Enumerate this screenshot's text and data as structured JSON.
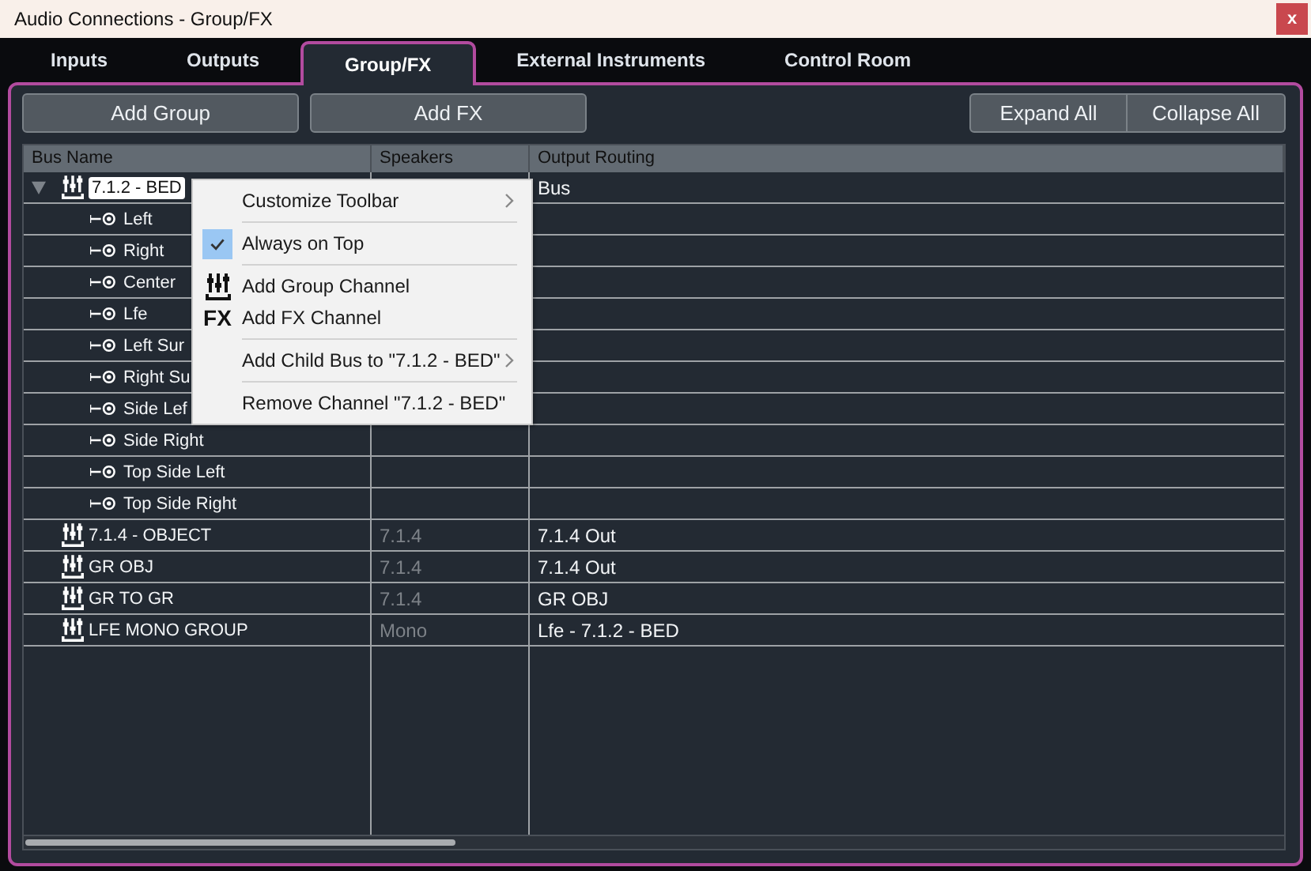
{
  "window": {
    "title": "Audio Connections - Group/FX",
    "close": "x"
  },
  "tabs": [
    {
      "label": "Inputs",
      "selected": false
    },
    {
      "label": "Outputs",
      "selected": false
    },
    {
      "label": "Group/FX",
      "selected": true
    },
    {
      "label": "External Instruments",
      "selected": false
    },
    {
      "label": "Control Room",
      "selected": false
    }
  ],
  "toolbar": {
    "left": [
      "Add Group",
      "Add FX"
    ],
    "right": [
      "Expand All",
      "Collapse All"
    ]
  },
  "table": {
    "columns": [
      "Bus Name",
      "Speakers",
      "Output Routing"
    ],
    "rows": [
      {
        "kind": "group",
        "name": "7.1.2 - BED",
        "editing": true,
        "expanded": true,
        "output": "Bus",
        "children": [
          {
            "kind": "channel",
            "name": "Left"
          },
          {
            "kind": "channel",
            "name": "Right"
          },
          {
            "kind": "channel",
            "name": "Center"
          },
          {
            "kind": "channel",
            "name": "Lfe"
          },
          {
            "kind": "channel",
            "name": "Left Sur"
          },
          {
            "kind": "channel",
            "name": "Right Su"
          },
          {
            "kind": "channel",
            "name": "Side Lef"
          },
          {
            "kind": "channel",
            "name": "Side Right"
          },
          {
            "kind": "channel",
            "name": "Top Side Left"
          },
          {
            "kind": "channel",
            "name": "Top Side Right"
          }
        ]
      },
      {
        "kind": "group",
        "name": "7.1.4 - OBJECT",
        "editing": false,
        "speakers": "7.1.4",
        "output": "7.1.4 Out"
      },
      {
        "kind": "group",
        "name": "GR OBJ",
        "editing": false,
        "speakers": "7.1.4",
        "output": "7.1.4 Out"
      },
      {
        "kind": "group",
        "name": "GR TO GR",
        "editing": false,
        "speakers": "7.1.4",
        "output": "GR OBJ"
      },
      {
        "kind": "group",
        "name": "LFE MONO GROUP",
        "editing": false,
        "speakers": "Mono",
        "output": "Lfe - 7.1.2 - BED"
      }
    ]
  },
  "context_menu": {
    "items": [
      {
        "kind": "submenu",
        "label": "Customize Toolbar"
      },
      {
        "kind": "separator"
      },
      {
        "kind": "check",
        "label": "Always on Top",
        "checked": true
      },
      {
        "kind": "separator"
      },
      {
        "kind": "group-icon",
        "label": "Add Group Channel"
      },
      {
        "kind": "text-icon",
        "icon": "FX",
        "label": "Add FX Channel"
      },
      {
        "kind": "separator"
      },
      {
        "kind": "submenu",
        "label": "Add Child Bus to \"7.1.2 - BED\""
      },
      {
        "kind": "separator"
      },
      {
        "kind": "plain",
        "label": "Remove Channel \"7.1.2 - BED\""
      }
    ]
  }
}
